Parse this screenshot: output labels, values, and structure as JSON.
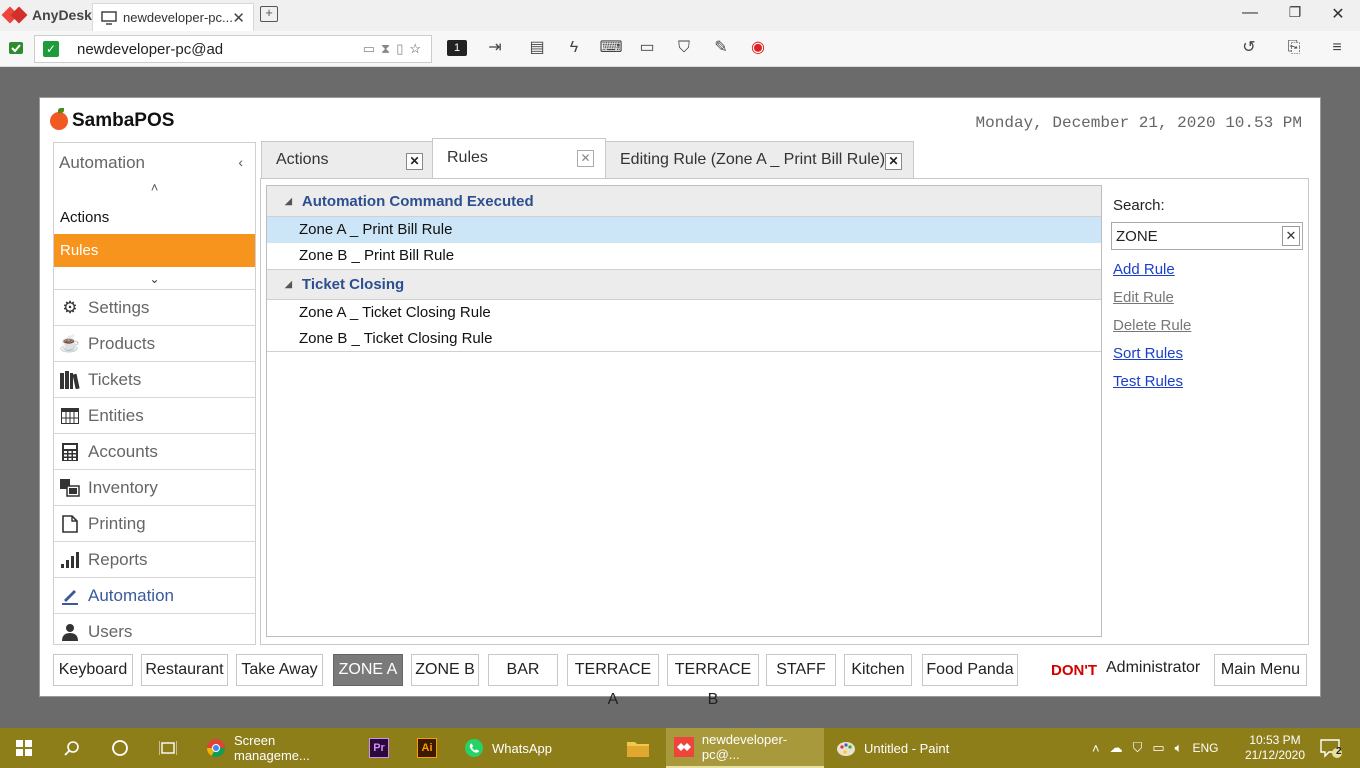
{
  "anydesk": {
    "app_name": "AnyDesk",
    "tab_title": "newdeveloper-pc...",
    "address": "newdeveloper-pc@ad",
    "session_number": "1"
  },
  "pos": {
    "brand": "SambaPOS",
    "datetime": "Monday, December 21, 2020 10.53 PM",
    "nav": {
      "header": "Automation",
      "sub_items": [
        "Actions",
        "Rules"
      ],
      "active_sub": "Rules",
      "items": [
        {
          "label": "Settings",
          "icon": "gear-icon"
        },
        {
          "label": "Products",
          "icon": "cup-icon"
        },
        {
          "label": "Tickets",
          "icon": "books-icon"
        },
        {
          "label": "Entities",
          "icon": "table-icon"
        },
        {
          "label": "Accounts",
          "icon": "calculator-icon"
        },
        {
          "label": "Inventory",
          "icon": "boxes-icon"
        },
        {
          "label": "Printing",
          "icon": "document-icon"
        },
        {
          "label": "Reports",
          "icon": "bar-chart-icon"
        },
        {
          "label": "Automation",
          "icon": "pencil-icon"
        },
        {
          "label": "Users",
          "icon": "user-icon"
        }
      ]
    },
    "tabs": [
      {
        "label": "Actions"
      },
      {
        "label": "Rules"
      },
      {
        "label": "Editing Rule (Zone A _ Print Bill Rule)"
      }
    ],
    "groups": [
      {
        "title": "Automation Command Executed",
        "rows": [
          "Zone A _ Print Bill Rule",
          "Zone B _ Print Bill Rule"
        ]
      },
      {
        "title": "Ticket Closing",
        "rows": [
          "Zone A _ Ticket Closing Rule",
          "Zone B _ Ticket Closing Rule"
        ]
      }
    ],
    "side": {
      "search_label": "Search:",
      "search_value": "ZONE",
      "links": [
        {
          "label": "Add Rule",
          "enabled": true
        },
        {
          "label": "Edit Rule",
          "enabled": false
        },
        {
          "label": "Delete Rule",
          "enabled": false
        },
        {
          "label": "Sort Rules",
          "enabled": true
        },
        {
          "label": "Test Rules",
          "enabled": true
        }
      ]
    },
    "bottom": {
      "buttons": [
        "Keyboard",
        "Restaurant",
        "Take Away",
        "ZONE A",
        "ZONE B",
        "BAR",
        "TERRACE A",
        "TERRACE B",
        "STAFF",
        "Kitchen",
        "Food Panda"
      ],
      "selected": "ZONE A",
      "warning": "DON'T",
      "user": "Administrator",
      "main_menu": "Main Menu"
    }
  },
  "taskbar": {
    "apps": [
      "Screen manageme...",
      "WhatsApp",
      "newdeveloper-pc@...",
      "Untitled - Paint"
    ],
    "lang": "ENG",
    "time": "10:53 PM",
    "date": "21/12/2020",
    "notifications": "2"
  },
  "colors": {
    "accent": "#f7941d",
    "link": "#1a3fc9",
    "group_title": "#2d4f8f",
    "selection": "#cde6f7",
    "taskbar": "#8e7e1a"
  }
}
